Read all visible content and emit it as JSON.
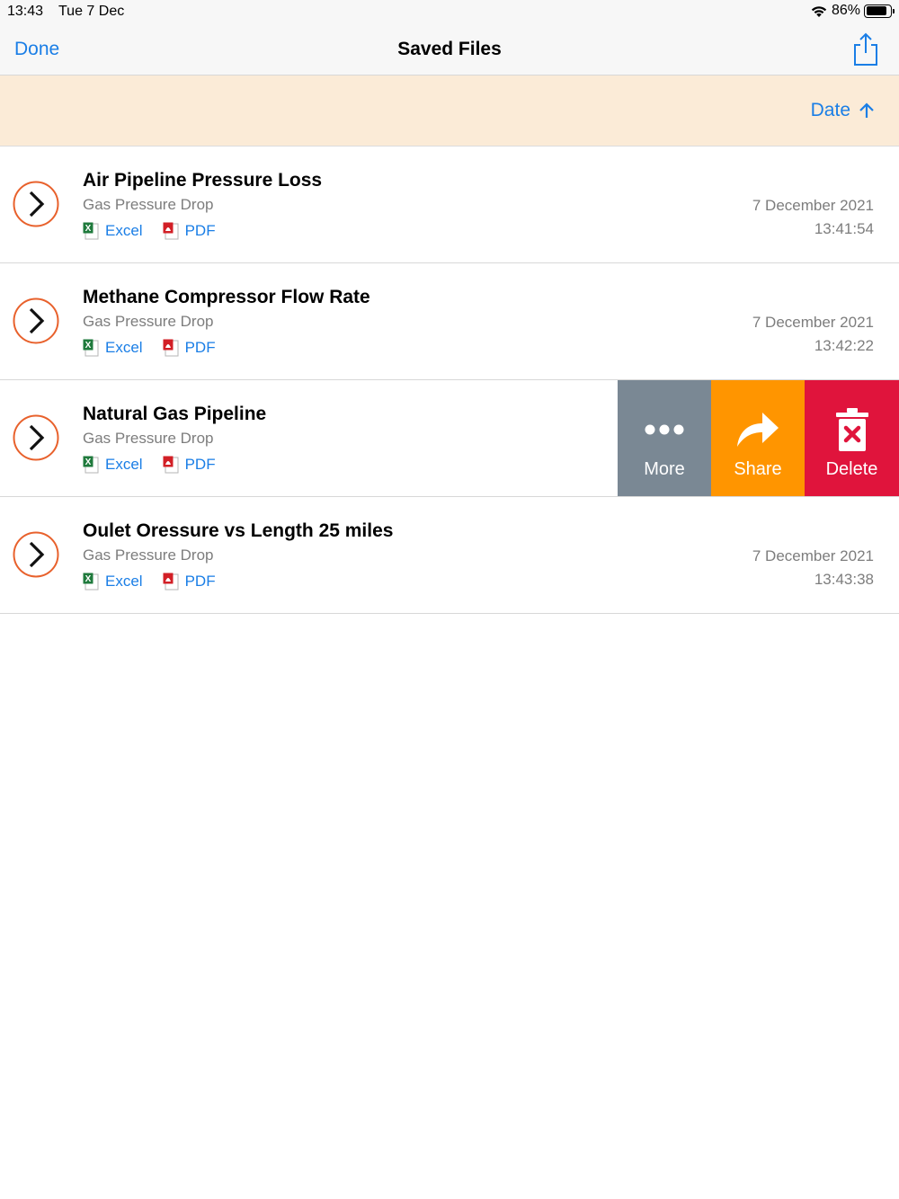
{
  "status_bar": {
    "time": "13:43",
    "date": "Tue 7 Dec",
    "battery": "86%",
    "battery_level": 0.86
  },
  "nav": {
    "done_label": "Done",
    "title": "Saved Files",
    "share_icon": "share-icon"
  },
  "sort": {
    "label": "Date",
    "direction_icon": "arrow-up-icon"
  },
  "colors": {
    "accent": "#1a7ee6",
    "sort_bar_bg": "#fbebd7",
    "chevron_ring": "#e8612c",
    "more": "#7a8894",
    "share": "#ff9500",
    "delete": "#e0143c"
  },
  "files": [
    {
      "title": "Air Pipeline Pressure Loss",
      "subtitle": "Gas Pressure Drop",
      "excel_label": "Excel",
      "pdf_label": "PDF",
      "date": "7 December 2021",
      "time": "13:41:54"
    },
    {
      "title": "Methane Compressor Flow Rate",
      "subtitle": "Gas Pressure Drop",
      "excel_label": "Excel",
      "pdf_label": "PDF",
      "date": "7 December 2021",
      "time": "13:42:22"
    },
    {
      "title": "Natural Gas Pipeline",
      "subtitle": "Gas Pressure Drop",
      "excel_label": "Excel",
      "pdf_label": "PDF",
      "swiped": true
    },
    {
      "title": "Oulet Oressure vs Length 25 miles",
      "subtitle": "Gas Pressure Drop",
      "excel_label": "Excel",
      "pdf_label": "PDF",
      "date": "7 December 2021",
      "time": "13:43:38"
    }
  ],
  "swipe_actions": {
    "more_label": "More",
    "share_label": "Share",
    "delete_label": "Delete"
  }
}
